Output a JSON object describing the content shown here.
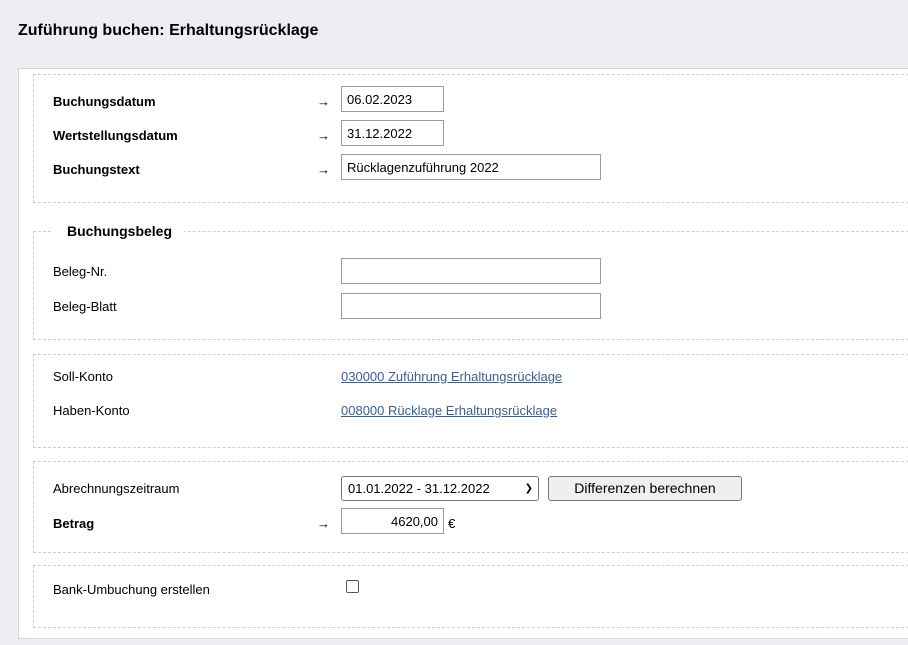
{
  "page": {
    "title": "Zuführung buchen: Erhaltungsrücklage"
  },
  "arrow_glyph": "→",
  "booking": {
    "date_label": "Buchungsdatum",
    "date_value": "06.02.2023",
    "value_date_label": "Wertstellungsdatum",
    "value_date_value": "31.12.2022",
    "text_label": "Buchungstext",
    "text_value": "Rücklagenzuführung 2022"
  },
  "voucher": {
    "legend": "Buchungsbeleg",
    "number_label": "Beleg-Nr.",
    "number_value": "",
    "sheet_label": "Beleg-Blatt",
    "sheet_value": ""
  },
  "accounts": {
    "debit_label": "Soll-Konto",
    "debit_link": "030000 Zuführung Erhaltungsrücklage",
    "credit_label": "Haben-Konto",
    "credit_link": "008000 Rücklage Erhaltungsrücklage"
  },
  "period": {
    "label": "Abrechnungszeitraum",
    "selected": "01.01.2022 - 31.12.2022",
    "calc_button": "Differenzen berechnen",
    "amount_label": "Betrag",
    "amount_value": "4620,00",
    "currency": "€"
  },
  "bank": {
    "label": "Bank-Umbuchung erstellen",
    "checked": false
  }
}
